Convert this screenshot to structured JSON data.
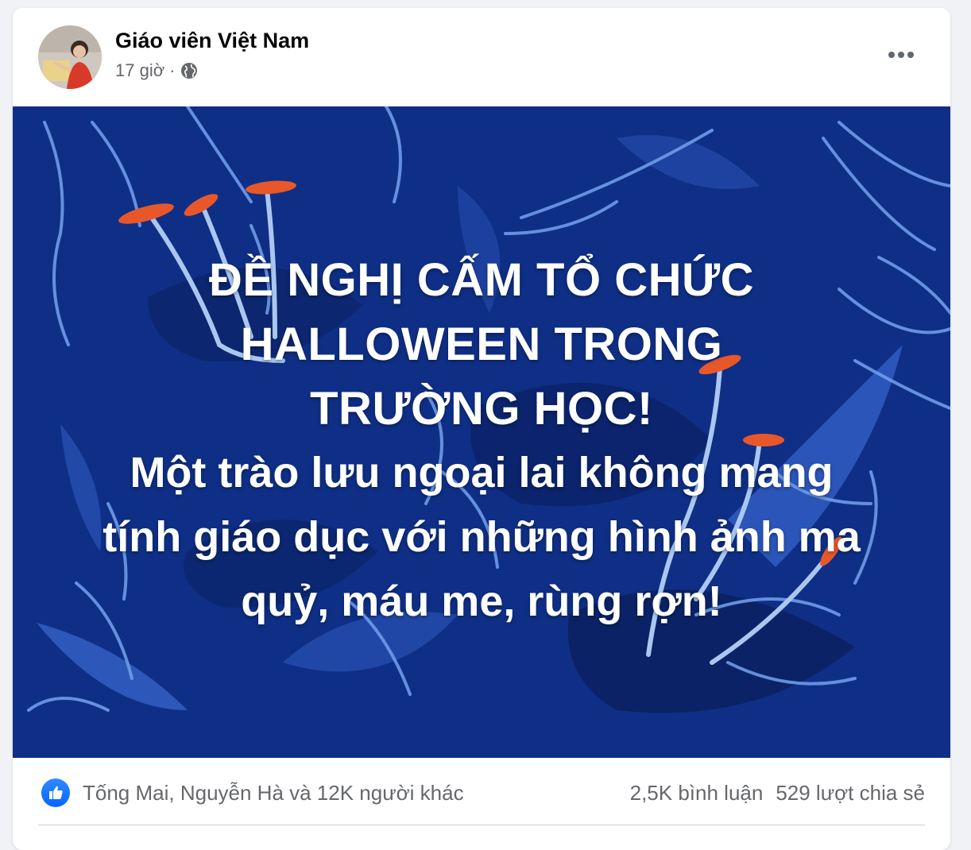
{
  "post": {
    "author": "Giáo viên Việt Nam",
    "time": "17 giờ",
    "separator": "·",
    "privacy_icon": "globe-icon",
    "more_icon": "more-horizontal-icon"
  },
  "banner": {
    "headline_lines": [
      "ĐỀ NGHỊ CẤM TỔ CHỨC",
      "HALLOWEEN TRONG",
      "TRƯỜNG HỌC!"
    ],
    "body_lines": [
      "Một trào lưu ngoại lai không mang",
      "tính giáo dục với những hình ảnh ma",
      "quỷ, máu me, rùng rợn!"
    ],
    "background_color": "#0f2f86",
    "accent_color": "#e8572a"
  },
  "footer": {
    "reaction_icon": "like-icon",
    "reactors": "Tống Mai, Nguyễn Hà và 12K người khác",
    "comments": "2,5K bình luận",
    "shares": "529 lượt chia sẻ"
  },
  "colors": {
    "like_blue": "#0866ff",
    "secondary_text": "#65676b",
    "primary_text": "#050505"
  }
}
